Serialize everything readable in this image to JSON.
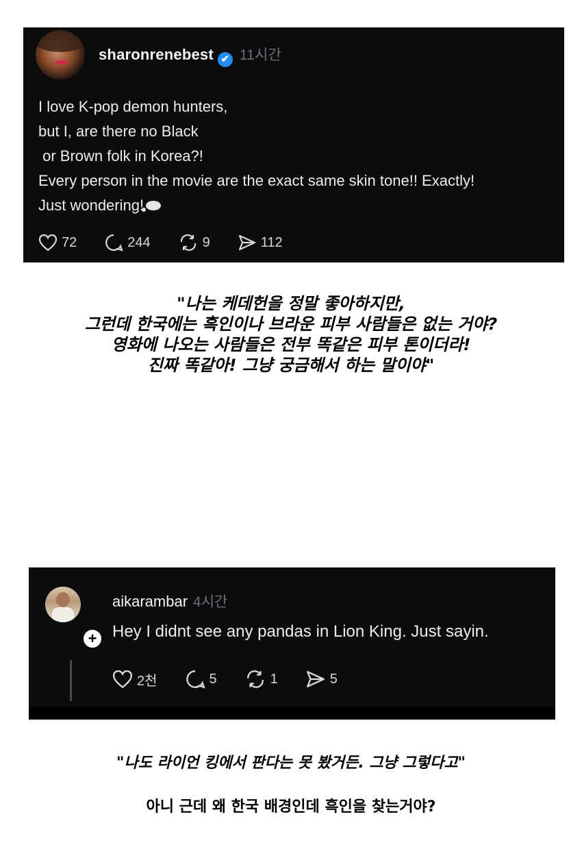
{
  "post1": {
    "username": "sharonrenebest",
    "verified_mark": "✔",
    "time": "11시간",
    "lines": [
      "I love K-pop demon hunters,",
      "but I, are there no Black",
      " or Brown folk in Korea?!",
      "Every person in the movie are the exact same skin tone!! Exactly!",
      "Just wondering!"
    ],
    "likes": "72",
    "comments": "244",
    "reposts": "9",
    "shares": "112"
  },
  "caption1": {
    "lines": [
      "\"나는 케데헌을 정말 좋아하지만,",
      "그런데 한국에는 흑인이나 브라운 피부 사람들은 없는 거야?",
      "영화에 나오는 사람들은 전부 똑같은 피부 톤이더라!",
      "진짜 똑같아! 그냥 궁금해서 하는 말이야\""
    ]
  },
  "post2": {
    "username": "aikarambar",
    "time": "4시간",
    "plus": "+",
    "text": "Hey I didnt see any pandas in Lion King. Just sayin.",
    "likes": "2천",
    "comments": "5",
    "reposts": "1",
    "shares": "5"
  },
  "caption2": "\"나도 라이언 킹에서 판다는 못 봤거든. 그냥 그렇다고\"",
  "caption3": "아니 근데 왜 한국 배경인데 흑인을 찾는거야?"
}
